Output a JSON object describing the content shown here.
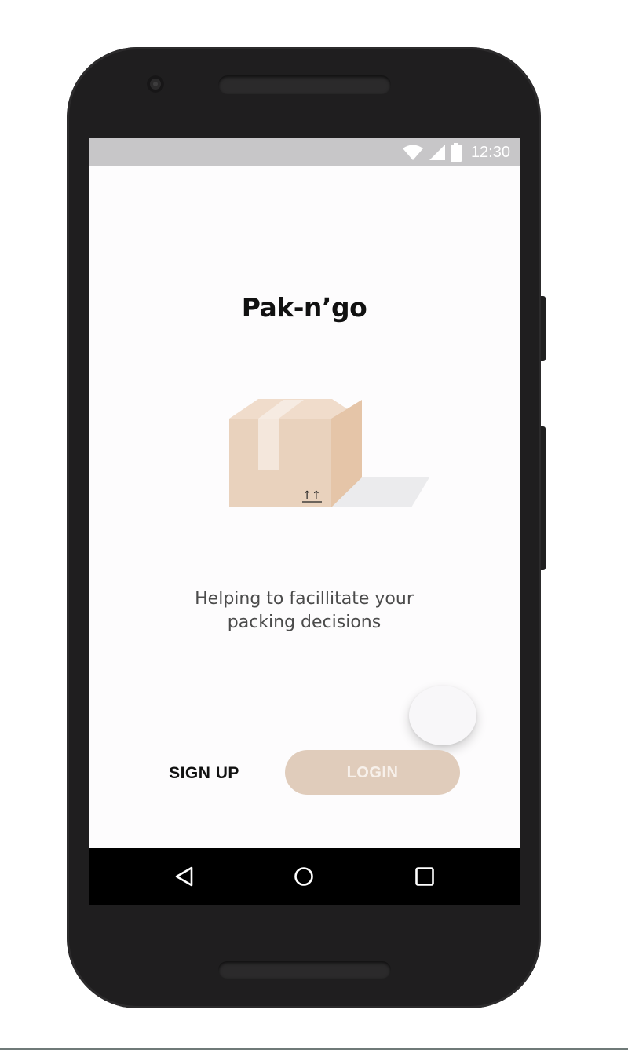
{
  "status_bar": {
    "time": "12:30",
    "icons": [
      "wifi-icon",
      "cell-signal-icon",
      "battery-icon"
    ]
  },
  "app": {
    "title": "Pak-n’go",
    "tagline_line1": "Helping to facillitate your",
    "tagline_line2": "packing decisions",
    "illustration": "cardboard-box-icon",
    "box_mark": "↑↑"
  },
  "actions": {
    "signup_label": "SIGN UP",
    "login_label": "LOGIN"
  },
  "nav_bar": {
    "icons": [
      "back-icon",
      "home-icon",
      "recent-apps-icon"
    ]
  },
  "colors": {
    "accent": "#e0ccbb",
    "box_front": "#e9d2bd",
    "status_bar": "#c7c6c8",
    "phone_body": "#1f1e1f"
  }
}
